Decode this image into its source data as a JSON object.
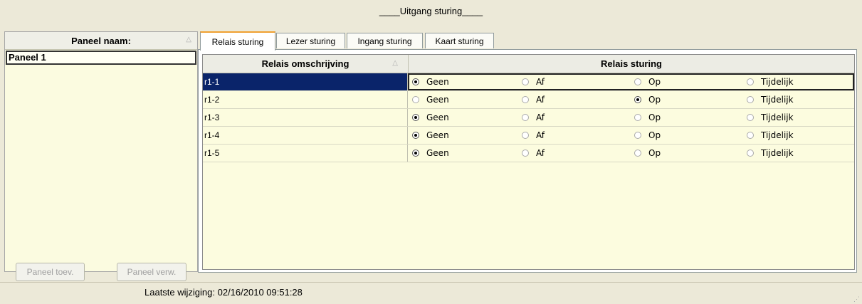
{
  "window": {
    "title": "____Uitgang sturing____"
  },
  "panels": {
    "header": "Paneel naam:",
    "items": [
      "Paneel 1"
    ],
    "add_button": "Paneel toev.",
    "remove_button": "Paneel verw."
  },
  "tabs": [
    "Relais sturing",
    "Lezer sturing",
    "Ingang sturing",
    "Kaart sturing"
  ],
  "active_tab": "Relais sturing",
  "grid": {
    "col_name": "Relais omschrijving",
    "col_control": "Relais sturing",
    "options": [
      "Geen",
      "Af",
      "Op",
      "Tijdelijk"
    ],
    "rows": [
      {
        "name": "r1-1",
        "selected": "Geen"
      },
      {
        "name": "r1-2",
        "selected": "Op"
      },
      {
        "name": "r1-3",
        "selected": "Geen"
      },
      {
        "name": "r1-4",
        "selected": "Geen"
      },
      {
        "name": "r1-5",
        "selected": "Geen"
      }
    ]
  },
  "status": {
    "last_change": "Laatste wijziging: 02/16/2010 09:51:28"
  }
}
